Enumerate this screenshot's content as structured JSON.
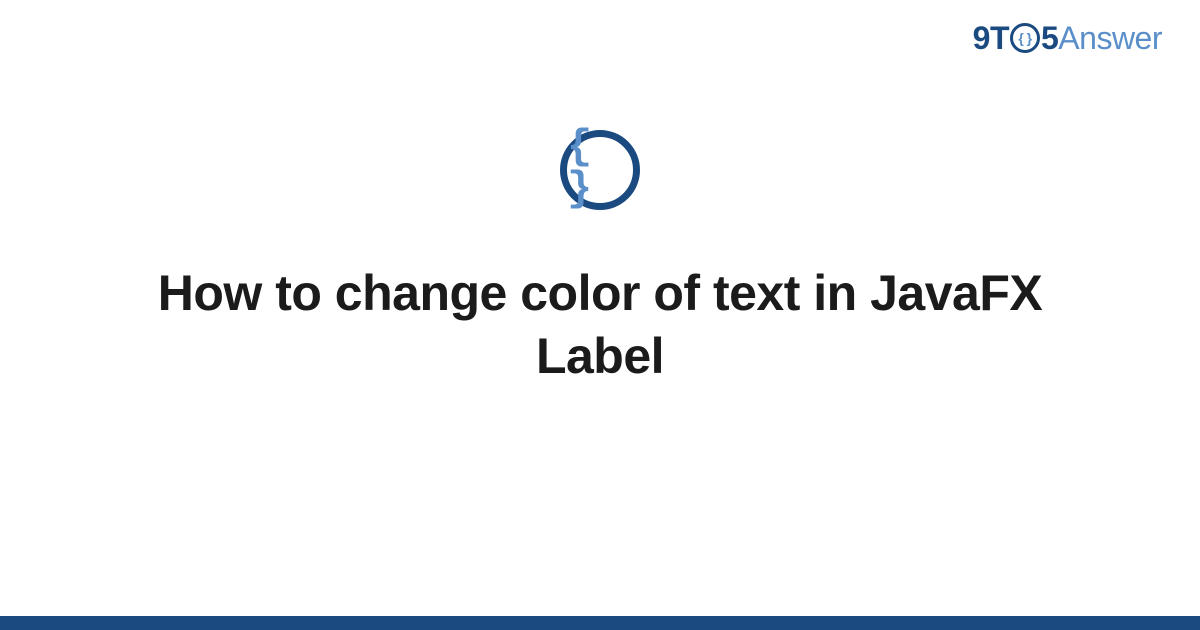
{
  "logo": {
    "part1": "9T",
    "circle_inner": "{ }",
    "part2": "5",
    "part3": "Answer"
  },
  "icon": {
    "braces": "{ }",
    "name": "code-braces-icon"
  },
  "title": "How to change color of text in JavaFX Label",
  "colors": {
    "primary": "#1b4a80",
    "secondary": "#5b8fc9",
    "text": "#1b1b1b",
    "background": "#ffffff"
  }
}
